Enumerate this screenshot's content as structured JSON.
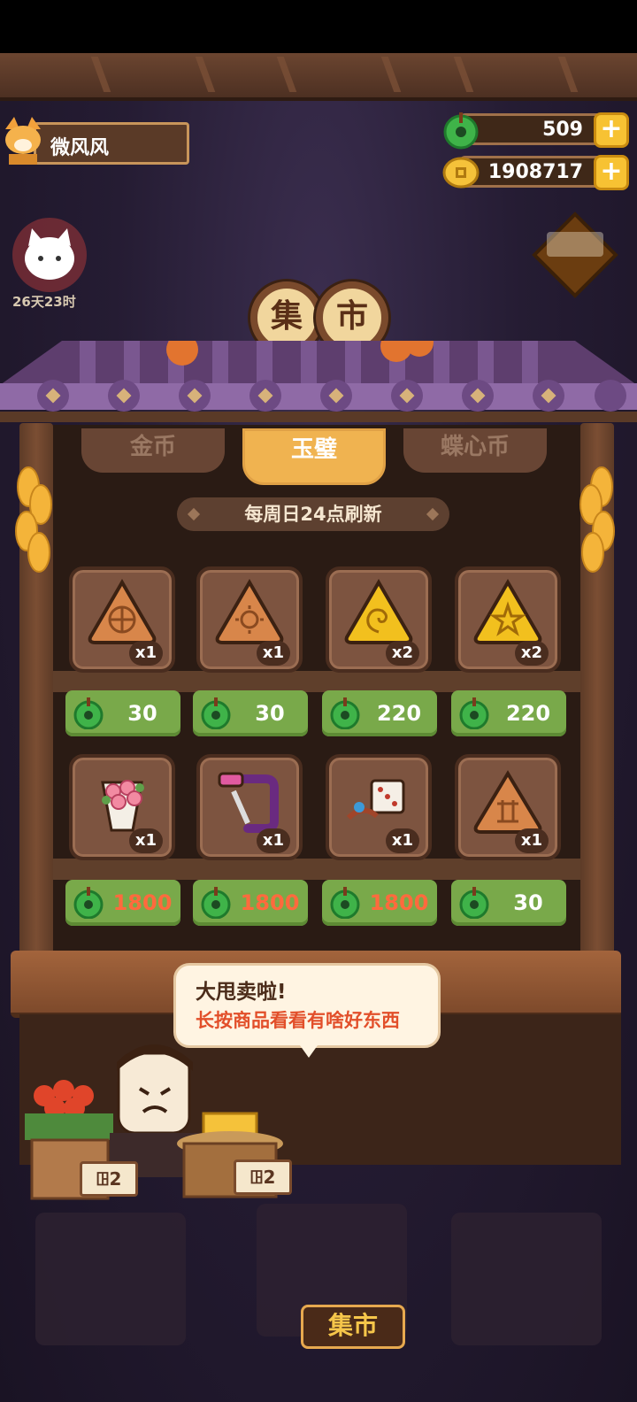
{
  "player": {
    "name": "微风风"
  },
  "currency": [
    {
      "icon": "jade-icon",
      "value": "509"
    },
    {
      "icon": "coin-icon",
      "value": "1908717"
    }
  ],
  "event": {
    "timer": "26天23时"
  },
  "title": {
    "chars": [
      "集",
      "市"
    ]
  },
  "tabs": [
    {
      "label": "金币",
      "active": false
    },
    {
      "label": "玉璧",
      "active": true
    },
    {
      "label": "蝶心币",
      "active": false
    }
  ],
  "refresh_text": "每周日24点刷新",
  "items": [
    {
      "icon": "wheel-rice-cake-icon",
      "qty": "x1",
      "price": "30",
      "affordable": true
    },
    {
      "icon": "sun-rice-cake-icon",
      "qty": "x1",
      "price": "30",
      "affordable": true
    },
    {
      "icon": "shell-rice-cake-icon",
      "qty": "x2",
      "price": "220",
      "affordable": true
    },
    {
      "icon": "star-rice-cake-icon",
      "qty": "x2",
      "price": "220",
      "affordable": true
    },
    {
      "icon": "flower-bouquet-icon",
      "qty": "x1",
      "price": "1800",
      "affordable": false
    },
    {
      "icon": "purple-saw-icon",
      "qty": "x1",
      "price": "1800",
      "affordable": false
    },
    {
      "icon": "dice-toy-icon",
      "qty": "x1",
      "price": "1800",
      "affordable": false
    },
    {
      "icon": "rune-rice-cake-icon",
      "qty": "x1",
      "price": "30",
      "affordable": true
    }
  ],
  "bubble": {
    "title": "大甩卖啦!",
    "text": "长按商品看看有啥好东西"
  },
  "tags": [
    "ꖸ2",
    "ꖸ2"
  ],
  "bottom_sign": "集市",
  "colors": {
    "price_bg": "#79a94a",
    "unaffordable_text": "#ff6a3d",
    "active_tab": "#f0b350"
  }
}
